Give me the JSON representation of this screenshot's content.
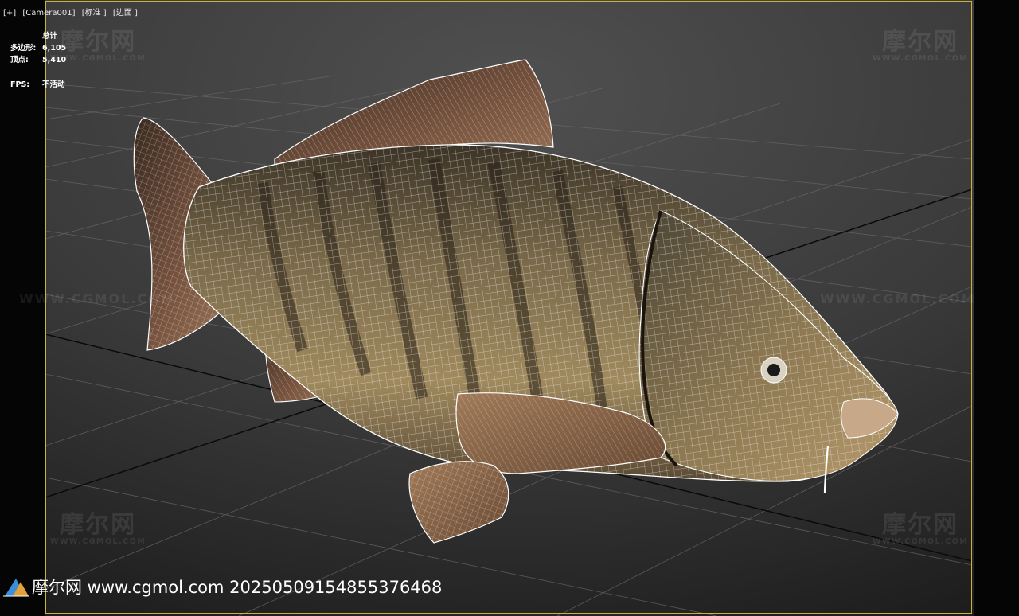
{
  "viewport": {
    "labels": [
      "[+]",
      "[Camera001]",
      "[标准 ]",
      "[边面 ]"
    ]
  },
  "stats": {
    "total_label": "总计",
    "polygons_label": "多边形:",
    "polygons_value": "6,105",
    "vertices_label": "顶点:",
    "vertices_value": "5,410",
    "fps_label": "FPS:",
    "fps_value": "不活动"
  },
  "watermark": {
    "logo_text": "摩尔网",
    "logo_sub": "WWW.CGMOL.COM",
    "url_text": "WWW.CGMOL.COM"
  },
  "footer": {
    "caption": "摩尔网 www.cgmol.com 20250509154855376468"
  },
  "colors": {
    "safe_frame": "#c8b23a",
    "background": "#1a1a1a",
    "wireframe": "#ffffff"
  }
}
